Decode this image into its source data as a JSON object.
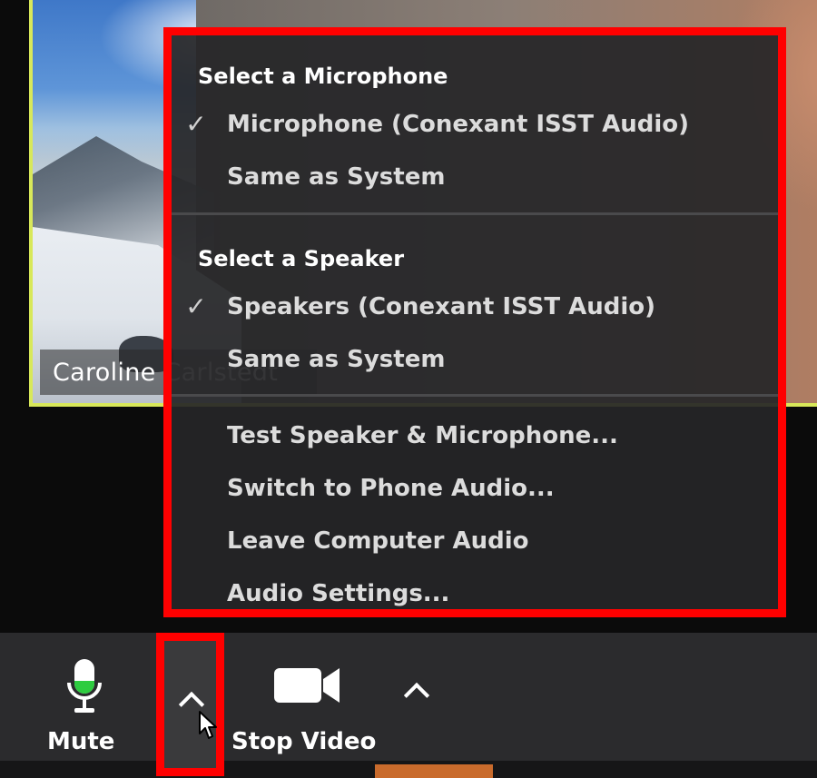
{
  "video_tile": {
    "participant_name": "Caroline Carlstedt"
  },
  "audio_menu": {
    "microphone_section": {
      "heading": "Select a Microphone",
      "items": [
        {
          "label": "Microphone (Conexant ISST Audio)",
          "checked": true
        },
        {
          "label": "Same as System",
          "checked": false
        }
      ]
    },
    "speaker_section": {
      "heading": "Select a Speaker",
      "items": [
        {
          "label": "Speakers (Conexant ISST Audio)",
          "checked": true
        },
        {
          "label": "Same as System",
          "checked": false
        }
      ]
    },
    "actions": [
      {
        "label": "Test Speaker & Microphone..."
      },
      {
        "label": "Switch to Phone Audio..."
      },
      {
        "label": "Leave Computer Audio"
      },
      {
        "label": "Audio Settings..."
      }
    ],
    "check_glyph": "✓",
    "highlight_color": "#ff0000"
  },
  "toolbar": {
    "mute_label": "Mute",
    "stop_video_label": "Stop Video",
    "mic_level_color": "#2ecc40"
  },
  "icons": {
    "microphone": "mic-icon",
    "camera": "camera-icon",
    "chevron": "chevron-up-icon",
    "cursor": "cursor-icon",
    "check": "checkmark-icon"
  }
}
